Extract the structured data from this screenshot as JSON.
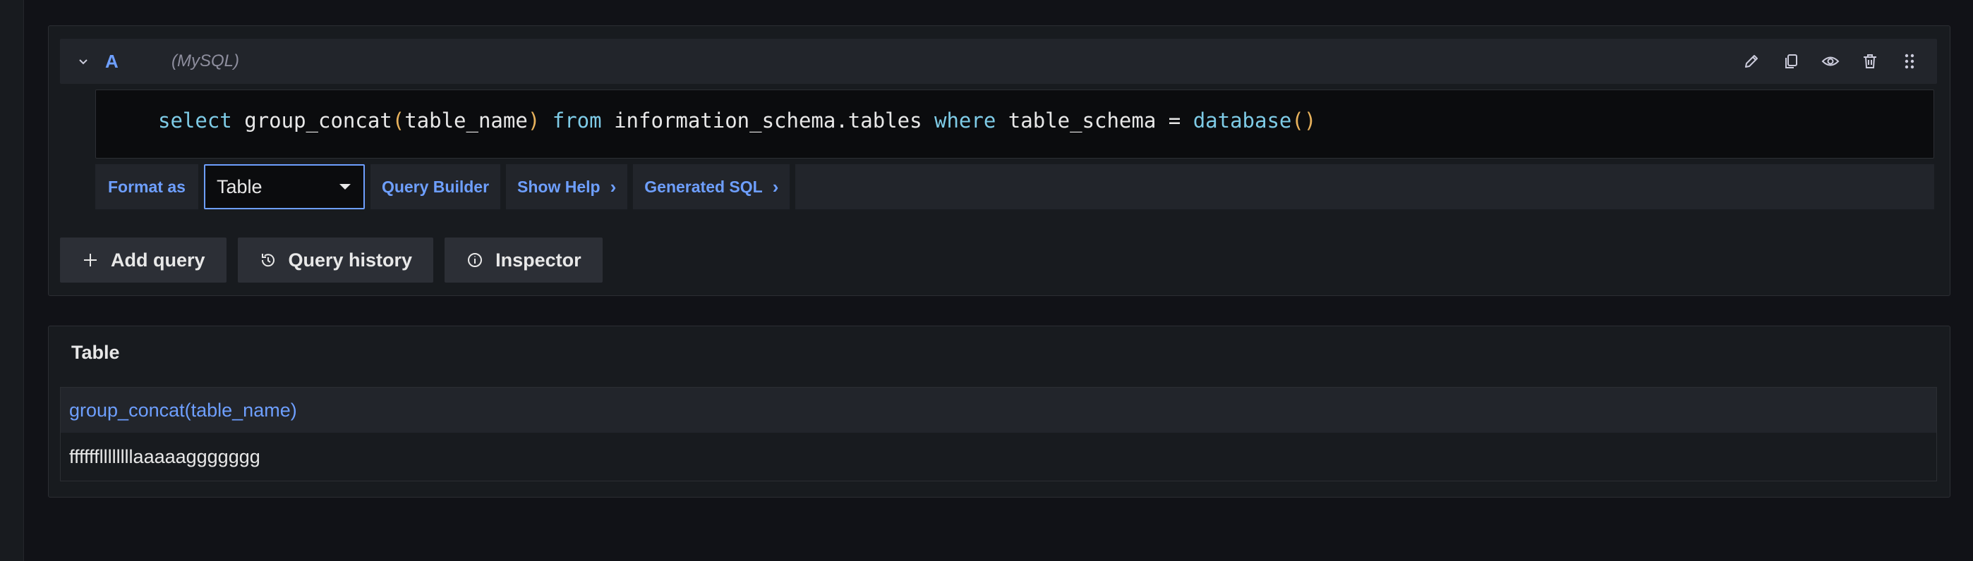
{
  "query": {
    "ref_id": "A",
    "datasource": "(MySQL)",
    "icons": [
      "chevron-down-icon",
      "pencil-icon",
      "copy-icon",
      "eye-icon",
      "trash-icon",
      "drag-handle-icon"
    ],
    "sql_tokens": [
      {
        "t": "select",
        "c": "kw"
      },
      {
        "t": " ",
        "c": "op"
      },
      {
        "t": "group_concat",
        "c": "fn"
      },
      {
        "t": "(",
        "c": "paren"
      },
      {
        "t": "table_name",
        "c": "id"
      },
      {
        "t": ")",
        "c": "paren"
      },
      {
        "t": " ",
        "c": "op"
      },
      {
        "t": "from",
        "c": "kw"
      },
      {
        "t": " information_schema.tables ",
        "c": "id"
      },
      {
        "t": "where",
        "c": "kw"
      },
      {
        "t": " table_schema = ",
        "c": "id"
      },
      {
        "t": "database",
        "c": "builtin"
      },
      {
        "t": "()",
        "c": "paren"
      }
    ]
  },
  "options": {
    "format_label": "Format as",
    "format_value": "Table",
    "query_builder": "Query Builder",
    "show_help": "Show Help",
    "generated_sql": "Generated SQL"
  },
  "actions": {
    "add_query": "Add query",
    "query_history": "Query history",
    "inspector": "Inspector"
  },
  "table": {
    "title": "Table",
    "columns": [
      "group_concat(table_name)"
    ],
    "rows": [
      [
        "ffffffllllllllaaaaaggggggg"
      ]
    ]
  },
  "colors": {
    "accent": "#6e9fff",
    "background": "#111217",
    "panel": "#181b1f",
    "keyword": "#7ecbe6",
    "paren": "#e8b25c"
  }
}
